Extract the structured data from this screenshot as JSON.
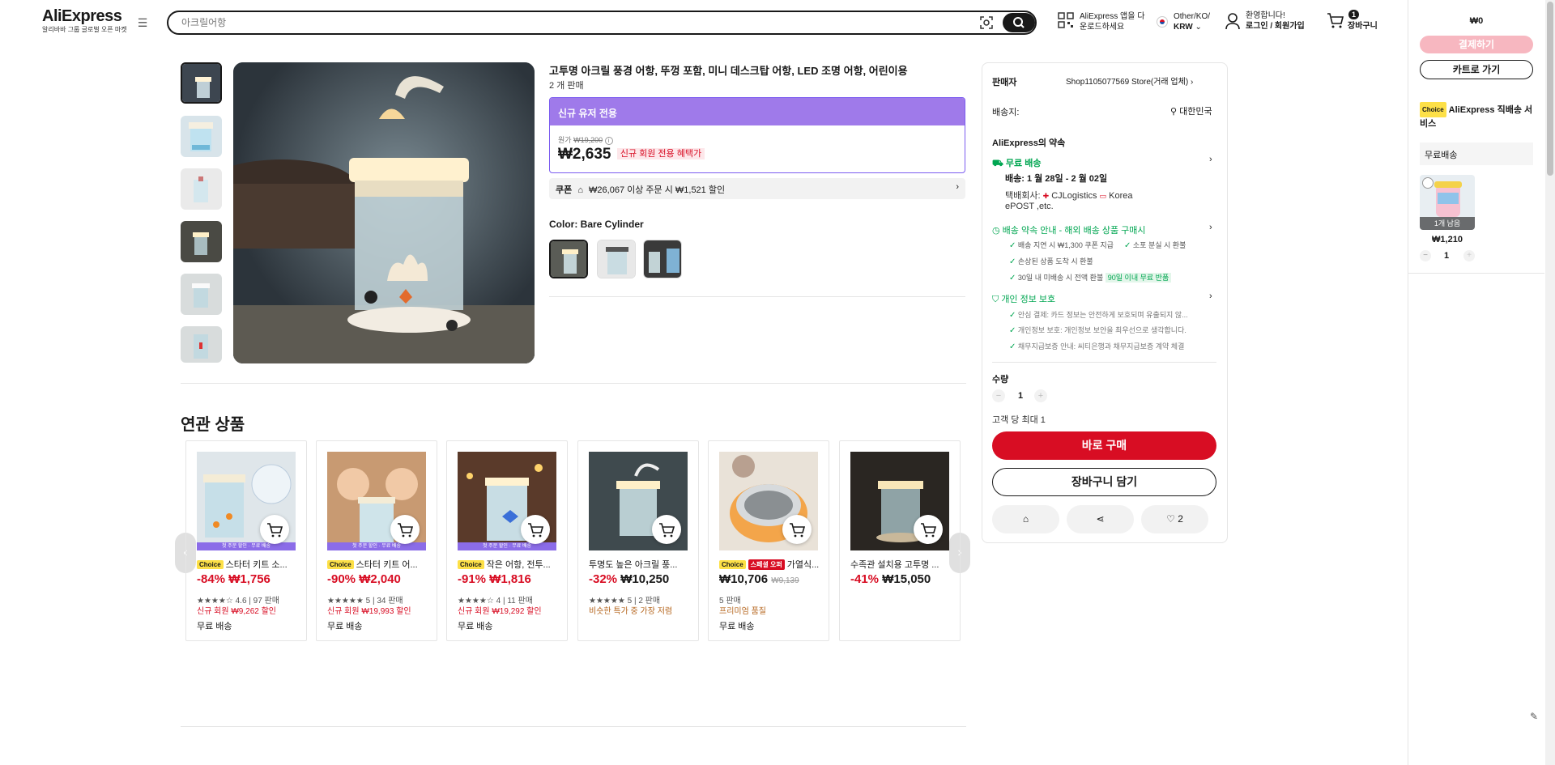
{
  "header": {
    "logo": "AliExpress",
    "logo_sub": "알리바바 그룹 글로벌 오픈 마켓",
    "search_placeholder": "아크릴어항",
    "app_line1": "AliExpress 앱을 다",
    "app_line2": "운로드하세요",
    "region_line1": "Other/KO/",
    "region_line2": "KRW",
    "account_line1": "환영합니다!",
    "account_line2": "로그인 / 회원가입",
    "cart_count": "1",
    "cart_label": "장바구니"
  },
  "product": {
    "title": "고투명 아크릴 풍경 어항, 뚜껑 포함, 미니 데스크탑 어항, LED 조명 어항, 어린이용",
    "sold": "2 개 판매",
    "new_user_banner": "신규 유저 전용",
    "original_label": "원가",
    "original_price": "₩19,200",
    "price": "₩2,635",
    "price_tag": "신규 회원 전용 혜택가",
    "coupon_label": "쿠폰",
    "coupon_text": "₩26,067 이상 주문 시 ₩1,521 할인",
    "color_label": "Color: Bare Cylinder"
  },
  "panel": {
    "seller_label": "판매자",
    "seller_name": "Shop1105077569 Store(거래 업체)",
    "ship_to_label": "배송지:",
    "ship_to": "대한민국",
    "promise_title": "AliExpress의 약속",
    "free_shipping": "무료 배송",
    "delivery": "배송: 1 월 28일 - 2 월 02일",
    "carrier_line1": "택배회사:",
    "carrier_line1b": "CJLogistics",
    "carrier_line1c": "Korea",
    "carrier_line2": "ePOST ,etc.",
    "guarantee_title": "배송 약속 안내 - 해외 배송 상품 구매시",
    "g1": "배송 지연 시 ₩1,300 쿠폰 지급",
    "g2": "소포 분실 시 환불",
    "g3": "손상된 상품 도착 시 환불",
    "g4": "30일 내 미배송 시 전액 환불",
    "g4_badge": "90일 이내 무료 반품",
    "privacy_title": "개인 정보 보호",
    "p1": "안심 결제: 카드 정보는 안전하게 보호되며 유출되지 않...",
    "p2": "개인정보 보호: 개인정보 보안을 최우선으로 생각합니다.",
    "p3": "채무지급보증 안내: 씨티은행과 채무지급보증 계약 체결",
    "qty_label": "수량",
    "qty": "1",
    "qty_limit": "고객 당 최대 1",
    "buy_now": "바로 구매",
    "add_cart": "장바구니 담기",
    "wish_count": "2"
  },
  "related": {
    "title": "연관 상품",
    "strip_text": "첫 주문 할인 · 무료 배송",
    "items": [
      {
        "choice": "Choice",
        "title": "스타터 키트 소...",
        "discount": "-84%",
        "price": "₩1,756",
        "meta": "★★★★☆ 4.6 | 97 판매",
        "promo": "신규 회원 ₩9,262 할인",
        "ship": "무료 배송"
      },
      {
        "choice": "Choice",
        "title": "스타터 키트 어...",
        "discount": "-90%",
        "price": "₩2,040",
        "meta": "★★★★★ 5 | 34 판매",
        "promo": "신규 회원 ₩19,993 할인",
        "ship": "무료 배송"
      },
      {
        "choice": "Choice",
        "title": "작은 어항, 전투...",
        "discount": "-91%",
        "price": "₩1,816",
        "meta": "★★★★☆ 4 | 11 판매",
        "promo": "신규 회원 ₩19,292 할인",
        "ship": "무료 배송"
      },
      {
        "choice": "",
        "title": "투명도 높은 아크릴 풍...",
        "discount": "-32%",
        "price": "₩10,250",
        "meta": "★★★★★ 5 | 2 판매",
        "promo": "비슷한 특가 중 가장 저렴",
        "ship": ""
      },
      {
        "choice": "Choice",
        "badge2": "스페셜 오퍼",
        "title": "가열식...",
        "discount": "",
        "price": "₩10,706",
        "old": "₩9,139",
        "meta": "5 판매",
        "promo": "프리미엄 품질",
        "ship": "무료 배송"
      },
      {
        "choice": "",
        "title": "수족관 설치용 고투명 ...",
        "discount": "-41%",
        "price": "₩15,050",
        "meta": "",
        "promo": "",
        "ship": ""
      }
    ]
  },
  "cart_side": {
    "total": "₩0",
    "checkout": "결제하기",
    "go_cart": "카트로 가기",
    "choice": "Choice",
    "service": "AliExpress 직배송 서비스",
    "free_ship": "무료배송",
    "stock_left": "1개 남음",
    "item_price": "₩1,210",
    "item_qty": "1"
  },
  "colors": {
    "accent": "#d80d23",
    "purple": "#9f7aea",
    "green": "#00a651"
  }
}
